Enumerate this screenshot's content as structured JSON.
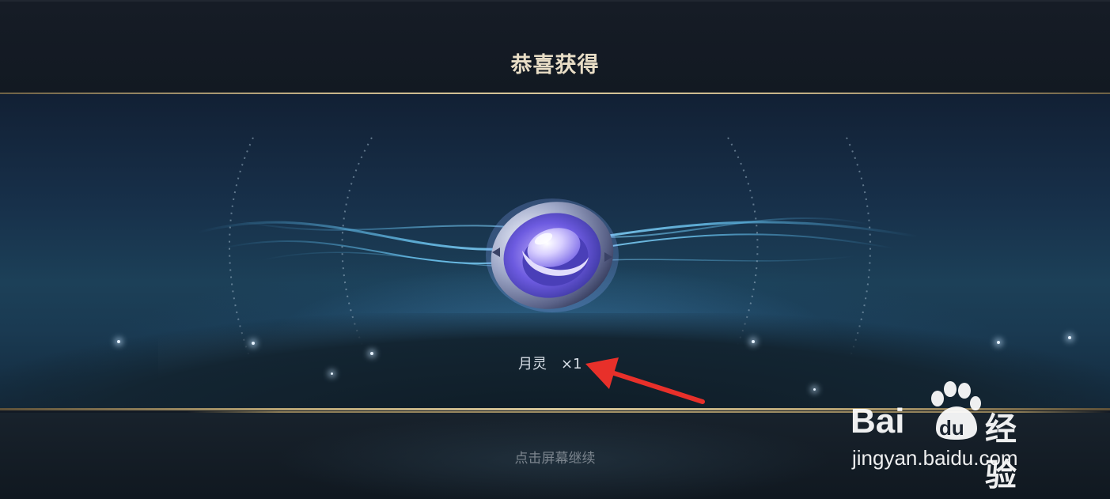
{
  "header": {
    "title": "恭喜获得"
  },
  "reward": {
    "name": "月灵",
    "quantity": "×1",
    "icon": "moon-spirit-medal-icon"
  },
  "footer": {
    "hint": "点击屏幕继续"
  },
  "watermark": {
    "logo_latin": "Bai",
    "logo_du": "du",
    "logo_cn": "经验",
    "url": "jingyan.baidu.com"
  },
  "colors": {
    "gold_accent": "#d9c89c",
    "title_color": "#e8ddc6",
    "arrow_red": "#e8302a"
  }
}
